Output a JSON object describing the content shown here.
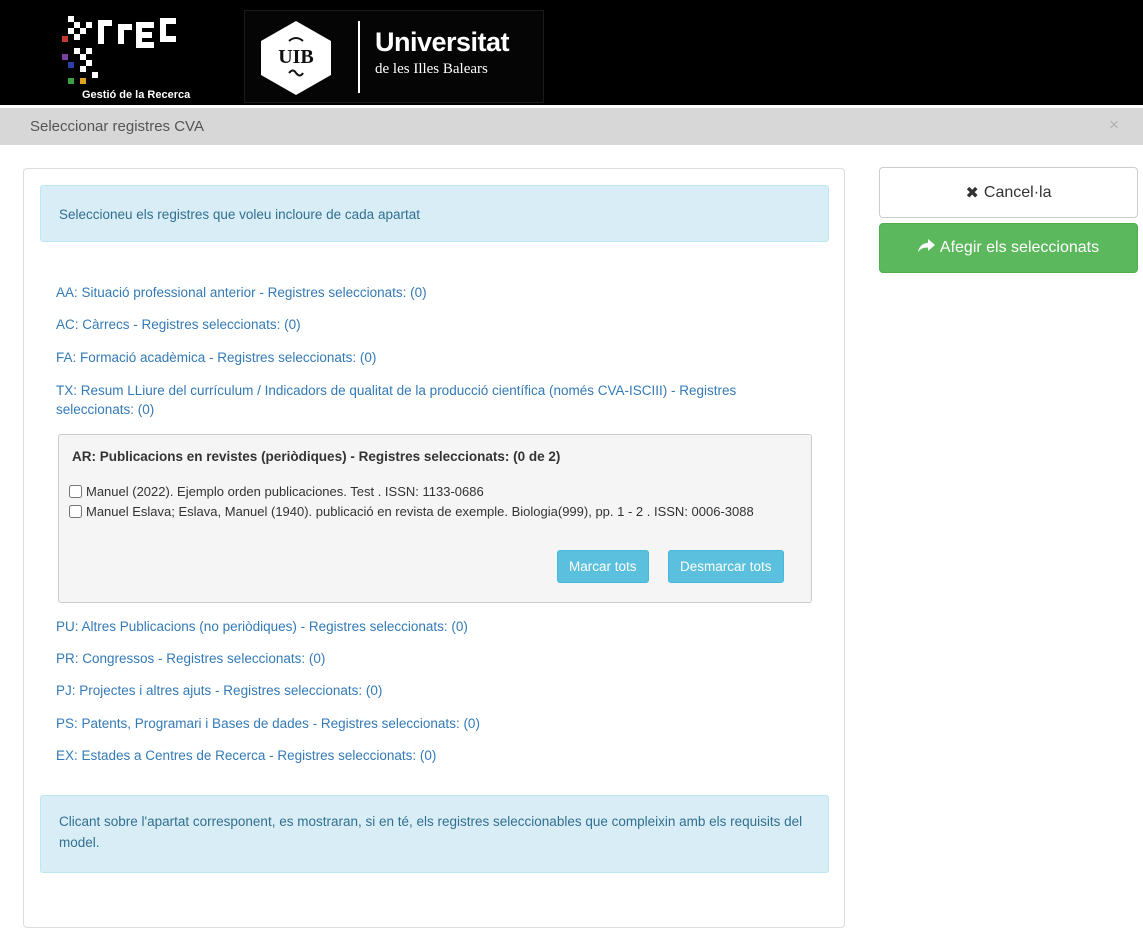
{
  "header": {
    "grec_subtitle": "Gestió de la Recerca",
    "uib_seal_text": "UIB",
    "uib_title": "Universitat",
    "uib_subtitle": "de les Illes Balears"
  },
  "modal": {
    "title": "Seleccionar registres CVA",
    "close_label": "×"
  },
  "info_top": "Seleccioneu els registres que voleu incloure de cada apartat",
  "sections_before": [
    "AA: Situació professional anterior - Registres seleccionats: (0)",
    "AC: Càrrecs - Registres seleccionats: (0)",
    "FA: Formació acadèmica - Registres seleccionats: (0)",
    "TX: Resum LLiure del currículum / Indicadors de qualitat de la producció científica (només CVA-ISCIII) - Registres seleccionats: (0)"
  ],
  "ar_section": {
    "title": "AR: Publicacions en revistes (periòdiques) - Registres seleccionats: (0 de 2)",
    "records": [
      "Manuel (2022). Ejemplo orden publicaciones. Test . ISSN: 1133-0686",
      "Manuel Eslava; Eslava, Manuel (1940). publicació en revista de exemple. Biologia(999), pp. 1 - 2 . ISSN: 0006-3088"
    ],
    "mark_all": "Marcar tots",
    "unmark_all": "Desmarcar tots"
  },
  "sections_after": [
    "PU: Altres Publicacions (no periòdiques) - Registres seleccionats: (0)",
    "PR: Congressos - Registres seleccionats: (0)",
    "PJ: Projectes i altres ajuts - Registres seleccionats: (0)",
    "PS: Patents, Programari i Bases de dades - Registres seleccionats: (0)",
    "EX: Estades a Centres de Recerca - Registres seleccionats: (0)"
  ],
  "info_bottom": "Clicant sobre l'apartat corresponent, es mostraran, si en té, els registres seleccionables que compleixin amb els requisits del model.",
  "buttons": {
    "cancel": "Cancel·la",
    "add_selected": "Afegir els seleccionats"
  },
  "colors": {
    "link": "#337ab7",
    "info_bg": "#d9edf7",
    "success": "#5cb85c",
    "button_info": "#5bc0de"
  }
}
